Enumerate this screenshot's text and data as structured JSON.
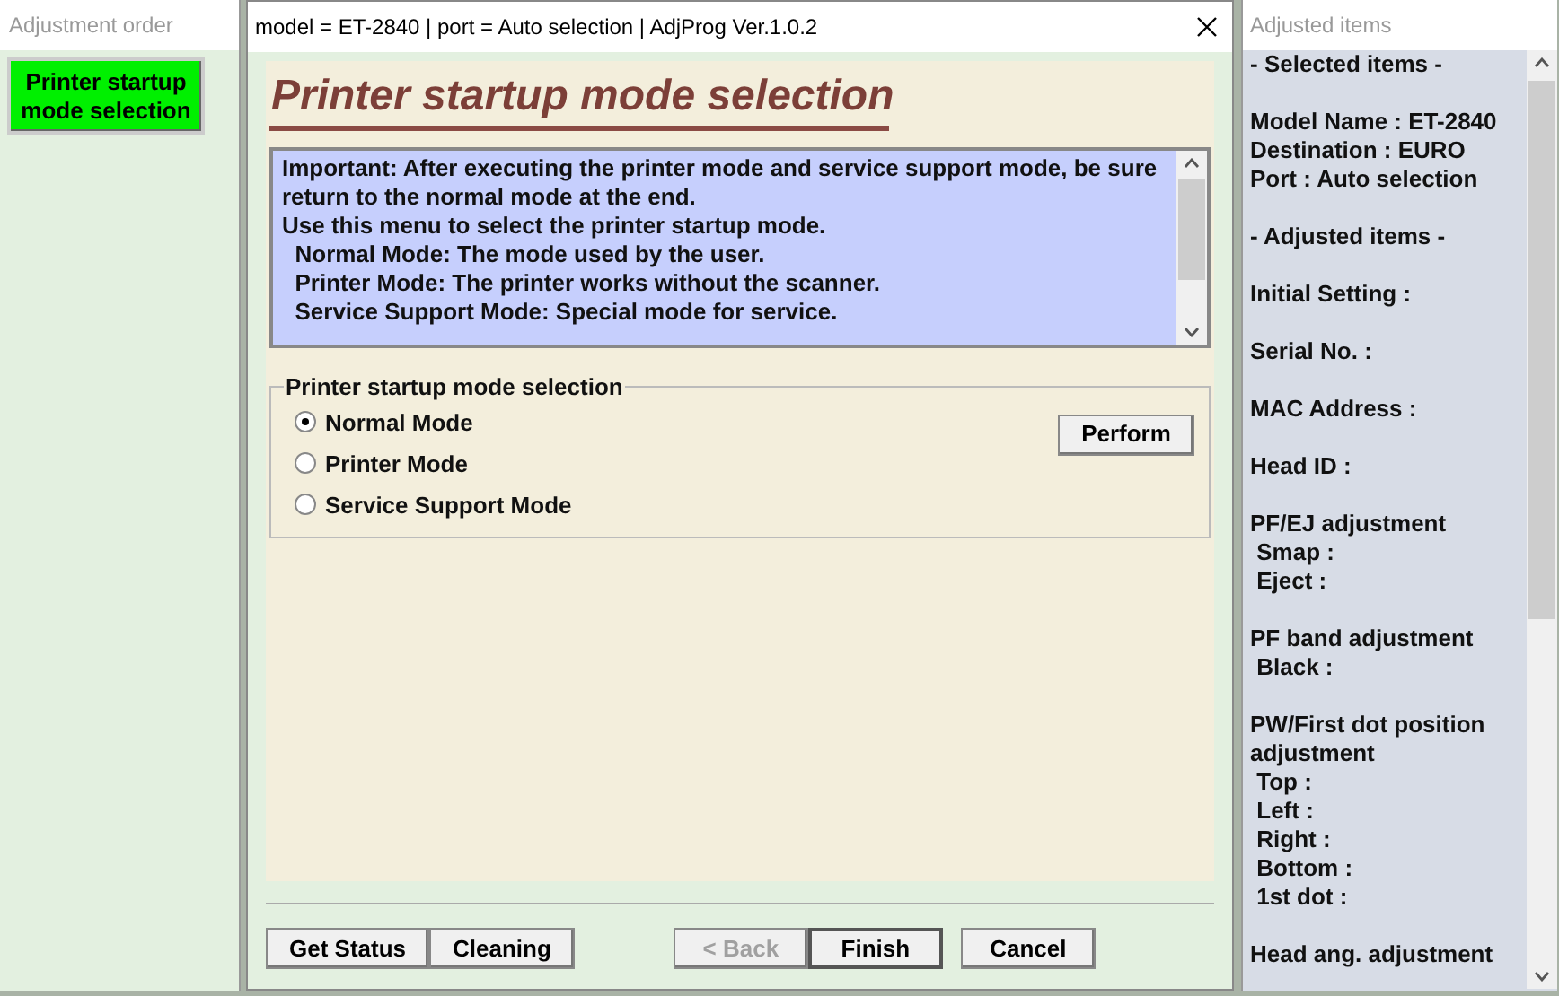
{
  "left_window": {
    "title": "Adjustment order",
    "items": [
      {
        "label": "Printer startup mode selection",
        "selected": true
      }
    ]
  },
  "dialog": {
    "title": "model = ET-2840 | port = Auto selection | AdjProg Ver.1.0.2",
    "heading": "Printer startup mode selection",
    "info_lines": [
      "Important: After executing the printer mode and service support mode, be sure return to the normal mode at the end.",
      "Use this menu to select the printer startup mode.",
      "  Normal Mode: The mode used by the user.",
      "  Printer Mode: The printer works without the scanner.",
      "  Service Support Mode: Special mode for service."
    ],
    "group": {
      "legend": "Printer startup mode selection",
      "options": [
        {
          "label": "Normal Mode",
          "selected": true
        },
        {
          "label": "Printer Mode",
          "selected": false
        },
        {
          "label": "Service Support Mode",
          "selected": false
        }
      ],
      "action": "Perform"
    },
    "left_buttons": [
      {
        "label": "Get Status",
        "disabled": false
      },
      {
        "label": "Cleaning",
        "disabled": false
      }
    ],
    "nav_buttons": [
      {
        "label": "< Back",
        "disabled": true,
        "default": false
      },
      {
        "label": "Finish",
        "disabled": false,
        "default": true
      },
      {
        "label": "Cancel",
        "disabled": false,
        "default": false
      }
    ]
  },
  "right_window": {
    "title": "Adjusted items",
    "groups": [
      [
        "- Selected items -"
      ],
      [
        "Model Name : ET-2840",
        "Destination : EURO",
        "Port : Auto selection"
      ],
      [
        "- Adjusted items -"
      ],
      [
        "Initial Setting :"
      ],
      [
        "Serial No. :"
      ],
      [
        "MAC Address :"
      ],
      [
        "Head ID :"
      ],
      [
        "PF/EJ adjustment",
        " Smap :",
        " Eject :"
      ],
      [
        "PF band adjustment",
        " Black :"
      ],
      [
        "PW/First dot position adjustment",
        " Top :",
        " Left :",
        " Right :",
        " Bottom :",
        " 1st dot :"
      ],
      [
        "Head ang. adjustment"
      ]
    ]
  }
}
